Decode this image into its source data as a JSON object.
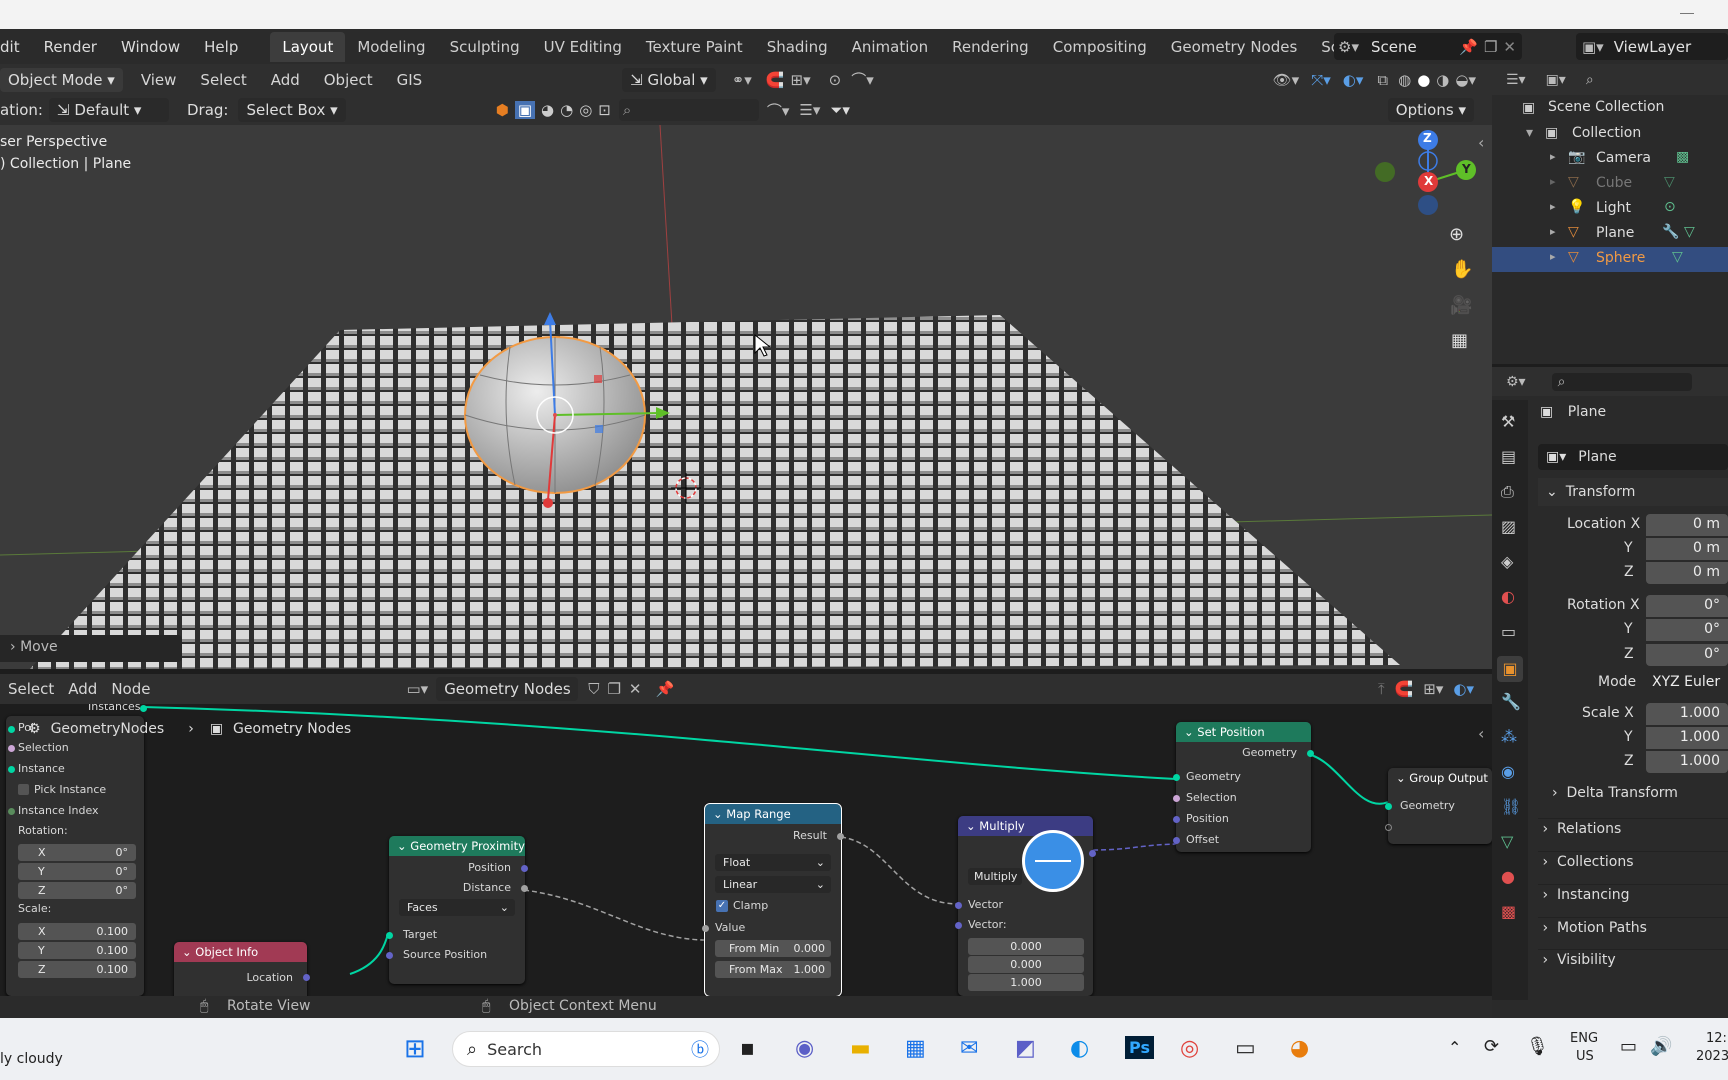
{
  "menus": [
    "dit",
    "Render",
    "Window",
    "Help"
  ],
  "workspaces": [
    "Layout",
    "Modeling",
    "Sculpting",
    "UV Editing",
    "Texture Paint",
    "Shading",
    "Animation",
    "Rendering",
    "Compositing",
    "Geometry Nodes",
    "Scripting"
  ],
  "active_workspace": "Layout",
  "scene_name": "Scene",
  "viewlayer_name": "ViewLayer",
  "viewport_header": {
    "mode": "Object Mode",
    "menus": [
      "View",
      "Select",
      "Add",
      "Object",
      "GIS"
    ],
    "transform_orientation": "Global",
    "orientation_label": "ation:",
    "orientation_value": "Default",
    "drag_label": "Drag:",
    "drag_value": "Select Box",
    "options_label": "Options"
  },
  "viewport": {
    "perspective_label": "ser Perspective",
    "context_label": ") Collection | Plane",
    "operator_panel": "Move",
    "gizmo_labels": {
      "z": "Z",
      "y": "Y",
      "x": "X"
    }
  },
  "outliner": {
    "root": "Scene Collection",
    "collection": "Collection",
    "items": [
      {
        "name": "Camera",
        "dim": false,
        "selected": false
      },
      {
        "name": "Cube",
        "dim": true,
        "selected": false
      },
      {
        "name": "Light",
        "dim": false,
        "selected": false
      },
      {
        "name": "Plane",
        "dim": false,
        "selected": false
      },
      {
        "name": "Sphere",
        "dim": false,
        "selected": true
      }
    ]
  },
  "properties": {
    "object_name": "Plane",
    "data_name": "Plane",
    "transform_label": "Transform",
    "location": {
      "label": "Location X",
      "x": "0 m",
      "y": "0 m",
      "z": "0 m"
    },
    "rotation": {
      "label": "Rotation X",
      "x": "0°",
      "y": "0°",
      "z": "0°"
    },
    "mode_label": "Mode",
    "mode_value": "XYZ Euler",
    "scale": {
      "label": "Scale X",
      "x": "1.000",
      "y": "1.000",
      "z": "1.000"
    },
    "axis_y": "Y",
    "axis_z": "Z",
    "sections": [
      "Delta Transform",
      "Relations",
      "Collections",
      "Instancing",
      "Motion Paths",
      "Visibility"
    ]
  },
  "node_editor": {
    "menus": [
      "Select",
      "Add",
      "Node"
    ],
    "tree_name": "Geometry Nodes",
    "breadcrumb_obj": "GeometryNodes",
    "breadcrumb_tree": "Geometry Nodes",
    "instances_label": "Instances",
    "left_node": {
      "rows": [
        "Poi",
        "Selection",
        "Instance",
        "Pick Instance",
        "Instance Index",
        "Rotation:"
      ],
      "rotation": {
        "x": "0°",
        "y": "0°",
        "z": "0°"
      },
      "scale_label": "Scale:",
      "scale": {
        "x": "0.100",
        "y": "0.100",
        "z": "0.100"
      },
      "axis": [
        "X",
        "Y",
        "Z"
      ]
    },
    "object_info": {
      "title": "Object Info",
      "location": "Location"
    },
    "geometry_proximity": {
      "title": "Geometry Proximity",
      "position": "Position",
      "distance": "Distance",
      "mode": "Faces",
      "target": "Target",
      "source": "Source Position"
    },
    "map_range": {
      "title": "Map Range",
      "result": "Result",
      "type": "Float",
      "interp": "Linear",
      "clamp": "Clamp",
      "value": "Value",
      "from_min_label": "From Min",
      "from_min": "0.000",
      "from_max_label": "From Max",
      "from_max": "1.000"
    },
    "multiply": {
      "title": "Multiply",
      "op": "Multiply",
      "vector": "Vector",
      "vector2": "Vector:",
      "v": [
        "0.000",
        "0.000",
        "1.000"
      ]
    },
    "set_position": {
      "title": "Set Position",
      "geometry_out": "Geometry",
      "geometry": "Geometry",
      "selection": "Selection",
      "position": "Position",
      "offset": "Offset"
    },
    "group_output": {
      "title": "Group Output",
      "geometry": "Geometry"
    }
  },
  "statusbar": {
    "left": "Rotate View",
    "right": "Object Context Menu"
  },
  "taskbar": {
    "weather": "ly cloudy",
    "search": "Search",
    "lang1": "ENG",
    "lang2": "US",
    "time": "12:",
    "date": "2023-"
  },
  "colors": {
    "accent_blue": "#4772b3",
    "selected_orange": "#f29a43",
    "geometry_socket": "#00d6a3",
    "vector_socket": "#6363c7",
    "float_socket": "#a1a1a1",
    "map_range_header": "#246283",
    "proximity_header": "#1e7a5c",
    "object_info_header": "#a13a54",
    "multiply_header": "#3c3c83",
    "set_position_header": "#1e7a5c"
  }
}
